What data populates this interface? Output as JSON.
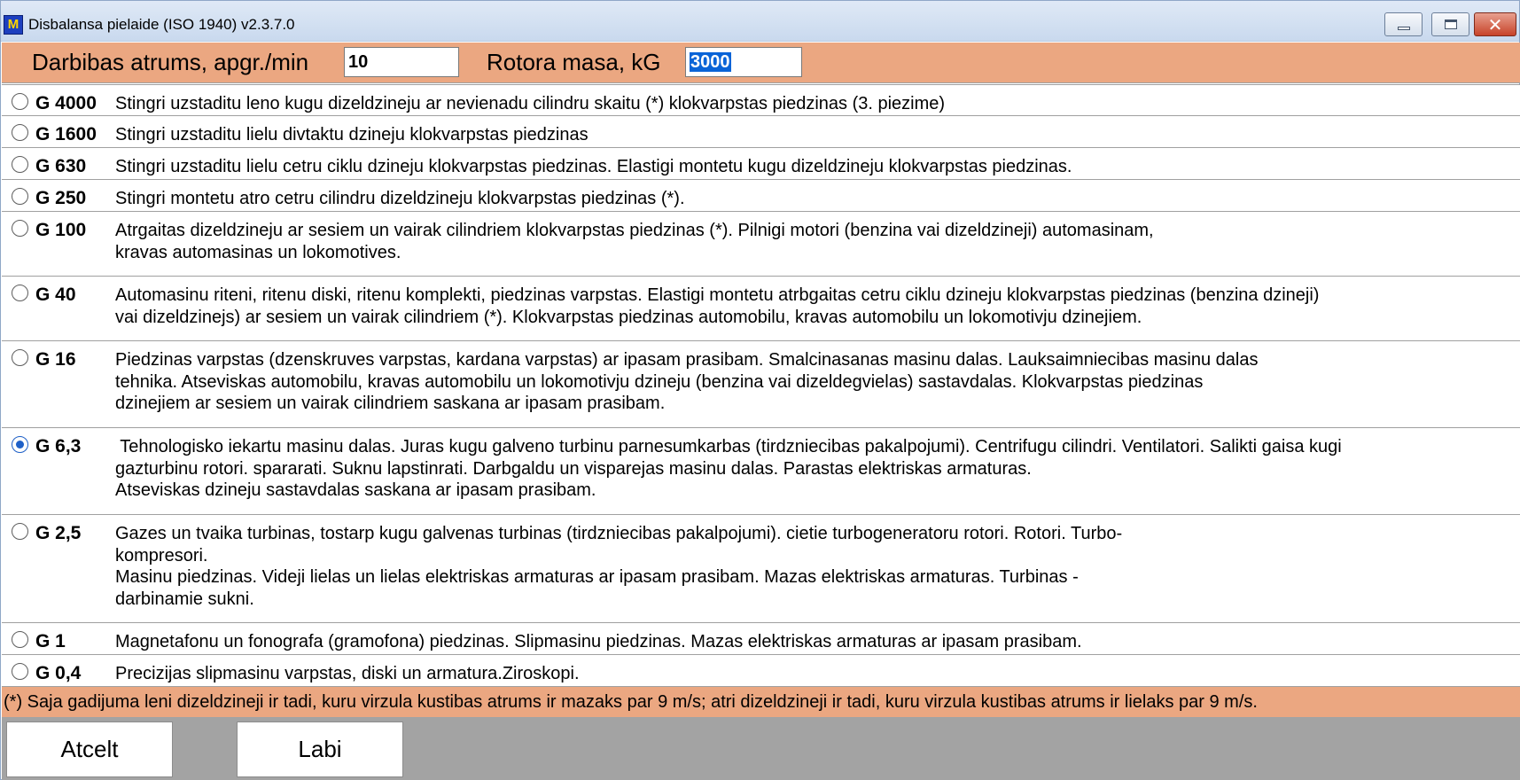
{
  "window": {
    "title": "Disbalansa pielaide (ISO 1940) v2.3.7.0",
    "icon_text": "M",
    "close_glyph": "✕"
  },
  "params": {
    "speed_label": "Darbibas atrums, apgr./min",
    "speed_value": "10",
    "mass_label": "Rotora masa, kG",
    "mass_value": "3000"
  },
  "grades": [
    {
      "grade": "G 4000",
      "checked": false,
      "lines": [
        "Stingri uzstaditu leno kugu dizeldzineju ar nevienadu cilindru skaitu (*) klokvarpstas piedzinas (3. piezime)"
      ]
    },
    {
      "grade": "G 1600",
      "checked": false,
      "lines": [
        "Stingri uzstaditu lielu divtaktu dzineju klokvarpstas piedzinas"
      ]
    },
    {
      "grade": "G 630",
      "checked": false,
      "lines": [
        "Stingri uzstaditu lielu cetru ciklu dzineju klokvarpstas piedzinas. Elastigi montetu kugu dizeldzineju klokvarpstas piedzinas."
      ]
    },
    {
      "grade": "G 250",
      "checked": false,
      "lines": [
        "Stingri montetu atro cetru cilindru dizeldzineju klokvarpstas piedzinas (*)."
      ]
    },
    {
      "grade": "G 100",
      "checked": false,
      "lines": [
        "Atrgaitas dizeldzineju ar sesiem un vairak cilindriem klokvarpstas piedzinas (*). Pilnigi motori (benzina vai dizeldzineji) automasinam,",
        "kravas automasinas un lokomotives."
      ]
    },
    {
      "grade": "G 40",
      "checked": false,
      "lines": [
        "Automasinu riteni, ritenu diski, ritenu komplekti, piedzinas varpstas. Elastigi montetu atrbgaitas cetru ciklu dzineju klokvarpstas piedzinas (benzina dzineji)",
        "vai dizeldzinejs) ar sesiem un vairak cilindriem (*). Klokvarpstas piedzinas automobilu, kravas automobilu un lokomotivju dzinejiem."
      ]
    },
    {
      "grade": "G 16",
      "checked": false,
      "lines": [
        "Piedzinas varpstas (dzenskruves varpstas, kardana varpstas) ar ipasam prasibam. Smalcinasanas masinu dalas. Lauksaimniecibas masinu dalas",
        "tehnika. Atseviskas automobilu, kravas automobilu un lokomotivju dzineju (benzina vai dizeldegvielas) sastavdalas. Klokvarpstas piedzinas",
        "dzinejiem ar sesiem un vairak cilindriem saskana ar ipasam prasibam."
      ]
    },
    {
      "grade": "G 6,3",
      "checked": true,
      "lines": [
        " Tehnologisko iekartu masinu dalas. Juras kugu galveno turbinu parnesumkarbas (tirdzniecibas pakalpojumi). Centrifugu cilindri. Ventilatori. Salikti gaisa kugi",
        "gazturbinu rotori. spararati. Suknu lapstinrati. Darbgaldu un visparejas masinu dalas. Parastas elektriskas armaturas.",
        "Atseviskas dzineju sastavdalas saskana ar ipasam prasibam."
      ]
    },
    {
      "grade": "G 2,5",
      "checked": false,
      "lines": [
        "Gazes un tvaika turbinas, tostarp kugu galvenas turbinas (tirdzniecibas pakalpojumi). cietie turbogeneratoru rotori. Rotori. Turbo-",
        "kompresori.",
        "Masinu piedzinas. Videji lielas un lielas elektriskas armaturas ar ipasam prasibam. Mazas elektriskas armaturas. Turbinas -",
        "darbinamie sukni."
      ]
    },
    {
      "grade": "G 1",
      "checked": false,
      "lines": [
        "Magnetafonu un fonografa (gramofona) piedzinas. Slipmasinu piedzinas. Mazas elektriskas armaturas ar ipasam prasibam."
      ]
    },
    {
      "grade": "G 0,4",
      "checked": false,
      "lines": [
        "Precizijas slipmasinu varpstas, diski un armatura.Ziroskopi."
      ]
    }
  ],
  "footnote": "(*) Saja gadijuma leni dizeldzineji ir tadi, kuru virzula kustibas atrums ir mazaks par 9 m/s; atri dizeldzineji ir tadi, kuru virzula kustibas atrums ir lielaks par 9 m/s.",
  "buttons": {
    "cancel_label": "Atcelt",
    "ok_label": "Labi"
  }
}
